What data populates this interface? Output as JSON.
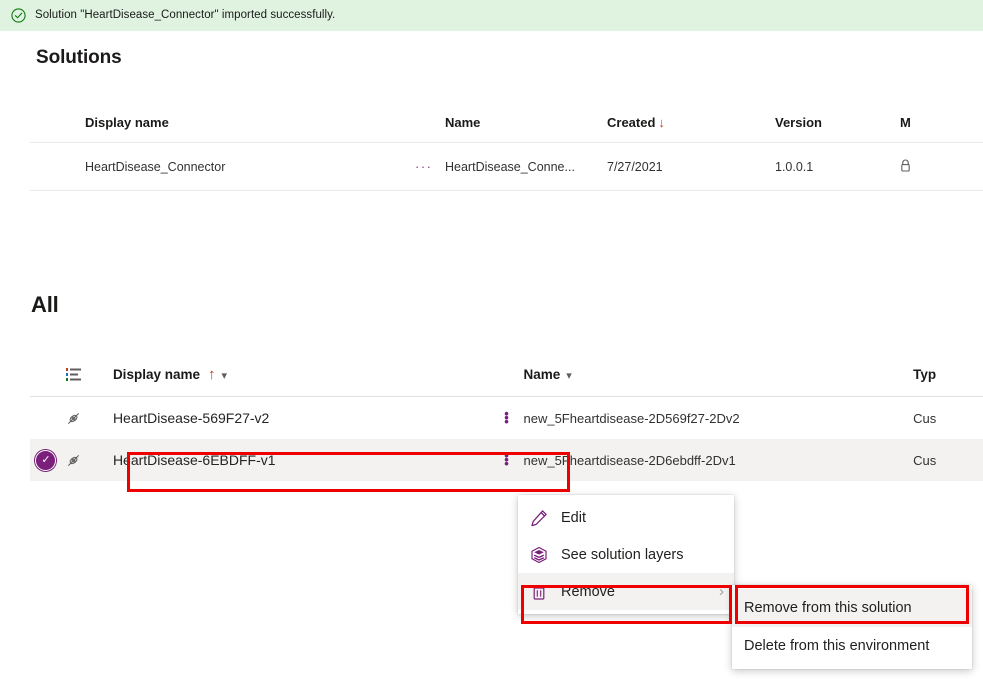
{
  "banner": {
    "icon": "check-circle-icon",
    "message": "Solution \"HeartDisease_Connector\" imported successfully.",
    "background_color": "#dff3e0",
    "icon_color": "#107c10"
  },
  "solutions_section": {
    "title": "Solutions",
    "columns": [
      "Display name",
      "Name",
      "Created",
      "Version",
      "M"
    ],
    "sort": {
      "column": "Created",
      "direction": "descending",
      "glyph": "↓"
    },
    "rows": [
      {
        "display_name": "HeartDisease_Connector",
        "overflow": "···",
        "name": "HeartDisease_Conne...",
        "created": "7/27/2021",
        "version": "1.0.0.1",
        "managed": "unmanaged-icon"
      }
    ]
  },
  "all_section": {
    "title": "All",
    "columns": {
      "list_icon": "row-list-icon",
      "display_name": "Display name",
      "display_name_sort": "↑",
      "display_name_chevron": "⌄",
      "name": "Name",
      "name_chevron": "⌄",
      "type": "Typ"
    },
    "rows": [
      {
        "selected": false,
        "type_icon": "unmanaged-icon",
        "display_name": "HeartDisease-569F27-v2",
        "kebab": "more-options-icon",
        "name": "new_5Fheartdisease-2D569f27-2Dv2",
        "type": "Cus"
      },
      {
        "selected": true,
        "selection_icon": "check-circle-filled-icon",
        "type_icon": "unmanaged-icon",
        "display_name": "HeartDisease-6EBDFF-v1",
        "kebab": "more-options-icon",
        "name": "new_5Fheartdisease-2D6ebdff-2Dv1",
        "type": "Cus"
      }
    ]
  },
  "context_menu": {
    "items": [
      {
        "icon": "pencil-icon",
        "label": "Edit",
        "has_submenu": false
      },
      {
        "icon": "layers-icon",
        "label": "See solution layers",
        "has_submenu": false
      },
      {
        "icon": "trash-icon",
        "label": "Remove",
        "has_submenu": true,
        "submenu_glyph": "›",
        "active": true
      }
    ]
  },
  "context_submenu": {
    "items": [
      {
        "label": "Remove from this solution",
        "hovered": true
      },
      {
        "label": "Delete from this environment",
        "hovered": false
      }
    ]
  },
  "annotations": {
    "accent_purple": "#7a1f7a",
    "highlight_red": "#ee0000",
    "selected_row_bg": "#f3f2f1"
  }
}
